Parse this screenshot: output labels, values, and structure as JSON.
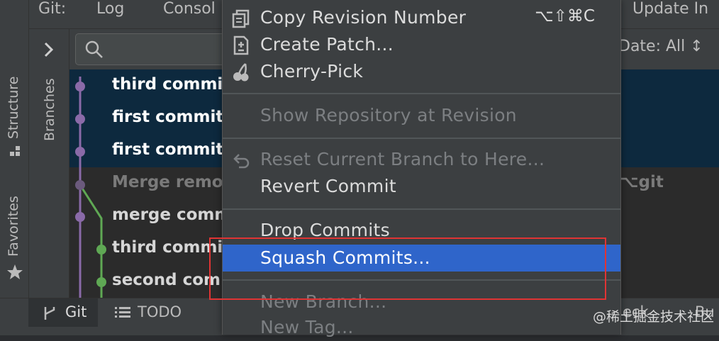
{
  "top_bar": {
    "git_label": "Git:",
    "log_tab": "Log",
    "console_tab": "Consol",
    "update_tab": "Update In"
  },
  "left_strip": {
    "structure_label": "Structure",
    "favorites_label": "Favorites"
  },
  "branches_label": "Branches",
  "search": {
    "placeholder": ""
  },
  "date_filter": "Date: All ↕",
  "commits": [
    {
      "text": "third commi",
      "selected": true
    },
    {
      "text": "first commit",
      "selected": true
    },
    {
      "text": "first commit",
      "selected": true
    },
    {
      "text": "Merge remo",
      "selected": false,
      "dim": true,
      "right_text": "⌥git"
    },
    {
      "text": "merge comm",
      "selected": false
    },
    {
      "text": "third commi",
      "selected": false
    },
    {
      "text": "second com",
      "selected": false
    }
  ],
  "context_menu": {
    "items": [
      {
        "label": "Copy Revision Number",
        "shortcut": "⌥⇧⌘C",
        "icon": "copy-icon"
      },
      {
        "label": "Create Patch...",
        "icon": "patch-icon"
      },
      {
        "label": "Cherry-Pick",
        "icon": "cherry-icon"
      },
      {
        "label": "Show Repository at Revision",
        "disabled": true
      },
      {
        "label": "Reset Current Branch to Here...",
        "disabled": true,
        "icon": "undo-icon"
      },
      {
        "label": "Revert Commit"
      },
      {
        "label": "Drop Commits"
      },
      {
        "label": "Squash Commits...",
        "highlighted": true
      },
      {
        "label": "New Branch...",
        "disabled": true
      },
      {
        "label": "New Tag...",
        "disabled": true
      }
    ]
  },
  "bottom_bar": {
    "git_tab": "Git",
    "todo_tab": "TODO",
    "check_tab": "eck",
    "build_tab": "Bu"
  },
  "watermark": "@稀土掘金技术社区",
  "colors": {
    "accent_highlight": "#2f65ca",
    "selection": "#0d293e",
    "annotation_red": "#e03434",
    "graph_purple": "#8a6aa8",
    "graph_green": "#5fa854"
  }
}
